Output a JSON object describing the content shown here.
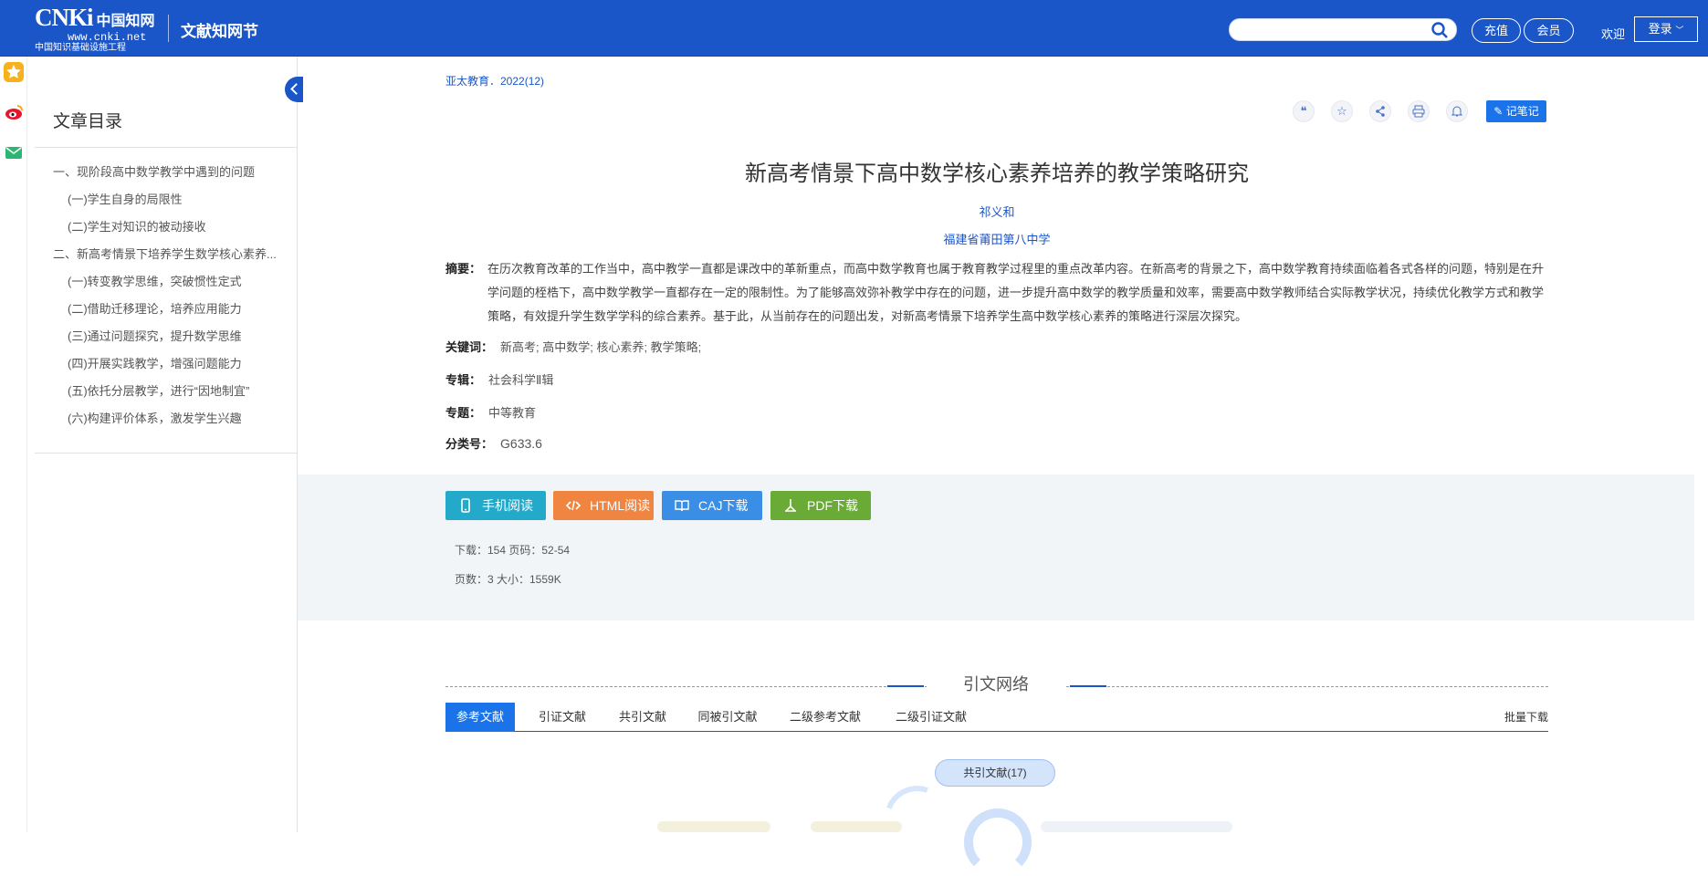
{
  "header": {
    "logo_text": "CNKi",
    "logo_cn": "中国知网",
    "logo_url": "www.cnki.net",
    "logo_sub": "中国知识基础设施工程",
    "site_name": "文献知网节",
    "search_placeholder": "",
    "recharge_label": "充值",
    "member_label": "会员",
    "welcome": "欢迎",
    "login_label": "登录",
    "colors": {
      "bar": "#1a56c8"
    }
  },
  "left_rail": {
    "icons": [
      "add-icon",
      "star-icon",
      "weibo-icon",
      "mail-icon"
    ]
  },
  "sidebar": {
    "title": "文章目录",
    "items": [
      {
        "label": "一、现阶段高中数学教学中遇到的问题",
        "level": 1
      },
      {
        "label": "(一)学生自身的局限性",
        "level": 2
      },
      {
        "label": "(二)学生对知识的被动接收",
        "level": 2
      },
      {
        "label": "二、新高考情景下培养学生数学核心素养...",
        "level": 1
      },
      {
        "label": "(一)转变教学思维，突破惯性定式",
        "level": 2
      },
      {
        "label": "(二)借助迁移理论，培养应用能力",
        "level": 2
      },
      {
        "label": "(三)通过问题探究，提升数学思维",
        "level": 2
      },
      {
        "label": "(四)开展实践教学，增强问题能力",
        "level": 2
      },
      {
        "label": "(五)依托分层教学，进行“因地制宜”",
        "level": 2
      },
      {
        "label": "(六)构建评价体系，激发学生兴趣",
        "level": 2
      }
    ]
  },
  "article": {
    "source": "亚太教育．2022(12)",
    "note_label": "记笔记",
    "title": "新高考情景下高中数学核心素养培养的教学策略研究",
    "author": "祁义和",
    "organization": "福建省莆田第八中学",
    "abstract_label": "摘要：",
    "abstract": "在历次教育改革的工作当中，高中教学一直都是课改中的革新重点，而高中数学教育也属于教育教学过程里的重点改革内容。在新高考的背景之下，高中数学教育持续面临着各式各样的问题，特别是在升学问题的桎梏下，高中数学教学一直都存在一定的限制性。为了能够高效弥补教学中存在的问题，进一步提升高中数学的教学质量和效率，需要高中数学教师结合实际教学状况，持续优化教学方式和教学策略，有效提升学生数学学科的综合素养。基于此，从当前存在的问题出发，对新高考情景下培养学生高中数学核心素养的策略进行深层次探究。",
    "keywords_label": "关键词：",
    "keywords": "新高考;  高中数学;  核心素养;  教学策略;",
    "series_label": "专辑：",
    "series": "社会科学Ⅱ辑",
    "topic_label": "专题：",
    "topic": "中等教育",
    "class_label": "分类号：",
    "class": "G633.6"
  },
  "download": {
    "buttons": [
      {
        "label": "手机阅读",
        "color": "#23a9c9"
      },
      {
        "label": "HTML阅读",
        "color": "#f08542"
      },
      {
        "label": "CAJ下载",
        "color": "#3a8ee6"
      },
      {
        "label": "PDF下载",
        "color": "#6aaa37"
      }
    ],
    "downloads_line": "下载：154    页码：52-54",
    "pages_line": "页数：3    大小：1559K"
  },
  "network": {
    "title": "引文网络",
    "tabs": [
      "参考文献",
      "引证文献",
      "共引文献",
      "同被引文献",
      "二级参考文献",
      "二级引证文献"
    ],
    "bulk": "批量下载",
    "node_label": "共引文献(17)"
  }
}
